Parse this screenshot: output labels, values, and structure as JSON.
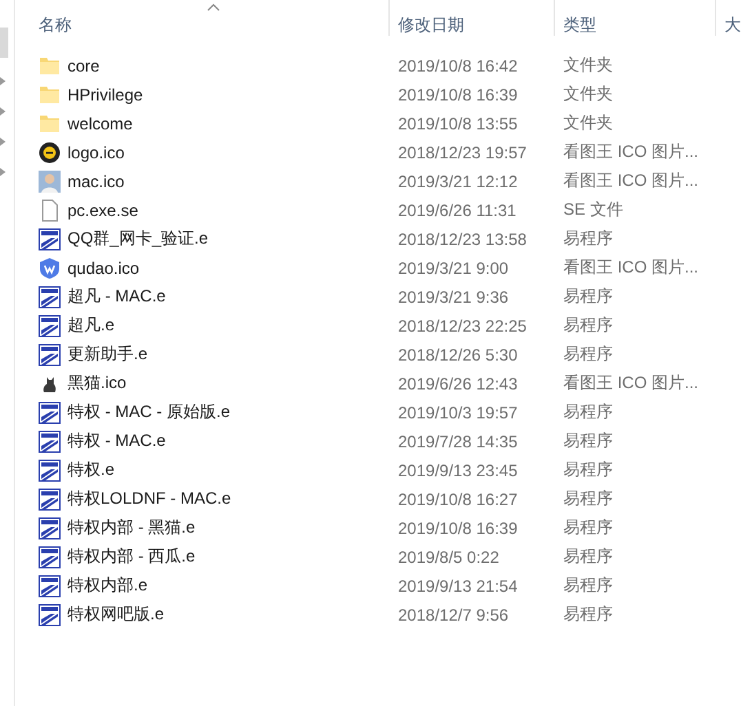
{
  "columns": [
    {
      "label": "名称",
      "sorted": true
    },
    {
      "label": "修改日期",
      "sorted": false
    },
    {
      "label": "类型",
      "sorted": false
    },
    {
      "label": "大",
      "sorted": false
    }
  ],
  "nav": [
    {
      "selected": true
    },
    {
      "selected": false
    },
    {
      "selected": false
    },
    {
      "selected": false
    },
    {
      "selected": false
    }
  ],
  "files": [
    {
      "name": "core",
      "date": "2019/10/8 16:42",
      "type": "文件夹",
      "kind": "folder"
    },
    {
      "name": "HPrivilege",
      "date": "2019/10/8 16:39",
      "type": "文件夹",
      "kind": "folder"
    },
    {
      "name": "welcome",
      "date": "2019/10/8 13:55",
      "type": "文件夹",
      "kind": "folder"
    },
    {
      "name": "logo.ico",
      "date": "2018/12/23 19:57",
      "type": "看图王 ICO 图片...",
      "kind": "logo"
    },
    {
      "name": "mac.ico",
      "date": "2019/3/21 12:12",
      "type": "看图王 ICO 图片...",
      "kind": "avatar"
    },
    {
      "name": "pc.exe.se",
      "date": "2019/6/26 11:31",
      "type": "SE 文件",
      "kind": "blank"
    },
    {
      "name": "QQ群_网卡_验证.e",
      "date": "2018/12/23 13:58",
      "type": "易程序",
      "kind": "program"
    },
    {
      "name": "qudao.ico",
      "date": "2019/3/21 9:00",
      "type": "看图王 ICO 图片...",
      "kind": "shield"
    },
    {
      "name": "超凡 - MAC.e",
      "date": "2019/3/21 9:36",
      "type": "易程序",
      "kind": "program"
    },
    {
      "name": "超凡.e",
      "date": "2018/12/23 22:25",
      "type": "易程序",
      "kind": "program"
    },
    {
      "name": "更新助手.e",
      "date": "2018/12/26 5:30",
      "type": "易程序",
      "kind": "program"
    },
    {
      "name": "黑猫.ico",
      "date": "2019/6/26 12:43",
      "type": "看图王 ICO 图片...",
      "kind": "cat"
    },
    {
      "name": "特权 - MAC - 原始版.e",
      "date": "2019/10/3 19:57",
      "type": "易程序",
      "kind": "program"
    },
    {
      "name": "特权 - MAC.e",
      "date": "2019/7/28 14:35",
      "type": "易程序",
      "kind": "program"
    },
    {
      "name": "特权.e",
      "date": "2019/9/13 23:45",
      "type": "易程序",
      "kind": "program"
    },
    {
      "name": "特权LOLDNF - MAC.e",
      "date": "2019/10/8 16:27",
      "type": "易程序",
      "kind": "program"
    },
    {
      "name": "特权内部 - 黑猫.e",
      "date": "2019/10/8 16:39",
      "type": "易程序",
      "kind": "program"
    },
    {
      "name": "特权内部 - 西瓜.e",
      "date": "2019/8/5 0:22",
      "type": "易程序",
      "kind": "program"
    },
    {
      "name": "特权内部.e",
      "date": "2019/9/13 21:54",
      "type": "易程序",
      "kind": "program"
    },
    {
      "name": "特权网吧版.e",
      "date": "2018/12/7 9:56",
      "type": "易程序",
      "kind": "program"
    }
  ]
}
